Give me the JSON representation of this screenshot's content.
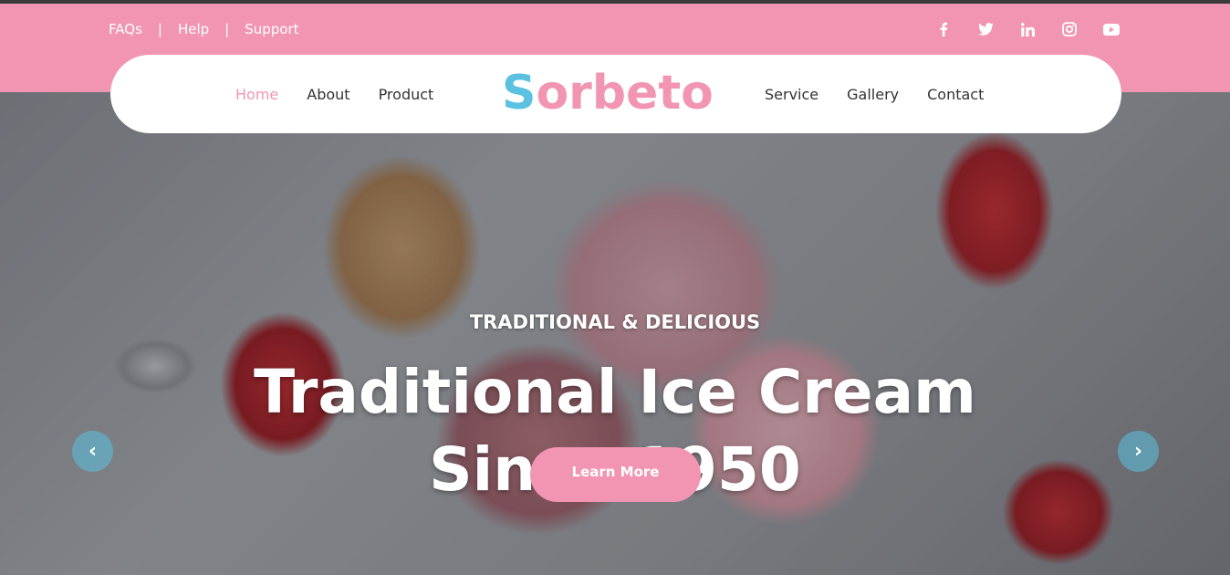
{
  "topbar": {
    "links": [
      "FAQs",
      "Help",
      "Support"
    ],
    "separator": "|",
    "social": [
      {
        "icon": "facebook-icon",
        "glyph": "f"
      },
      {
        "icon": "twitter-icon",
        "glyph": "🐦"
      },
      {
        "icon": "linkedin-icon",
        "glyph": "in"
      },
      {
        "icon": "instagram-icon",
        "glyph": "◎"
      },
      {
        "icon": "youtube-icon",
        "glyph": "▶"
      }
    ]
  },
  "nav": {
    "left": [
      "Home",
      "About",
      "Product"
    ],
    "right": [
      "Service",
      "Gallery",
      "Contact"
    ],
    "active": "Home"
  },
  "logo": {
    "first": "S",
    "rest": "orbeto"
  },
  "hero": {
    "subtitle": "TRADITIONAL & DELICIOUS",
    "title_line1": "Traditional Ice Cream",
    "title_line2": "Since 1950",
    "button": "Learn More",
    "prev_glyph": "‹",
    "next_glyph": "›"
  },
  "colors": {
    "brand_pink": "#f295b3",
    "brand_blue": "#5bc1e0"
  }
}
